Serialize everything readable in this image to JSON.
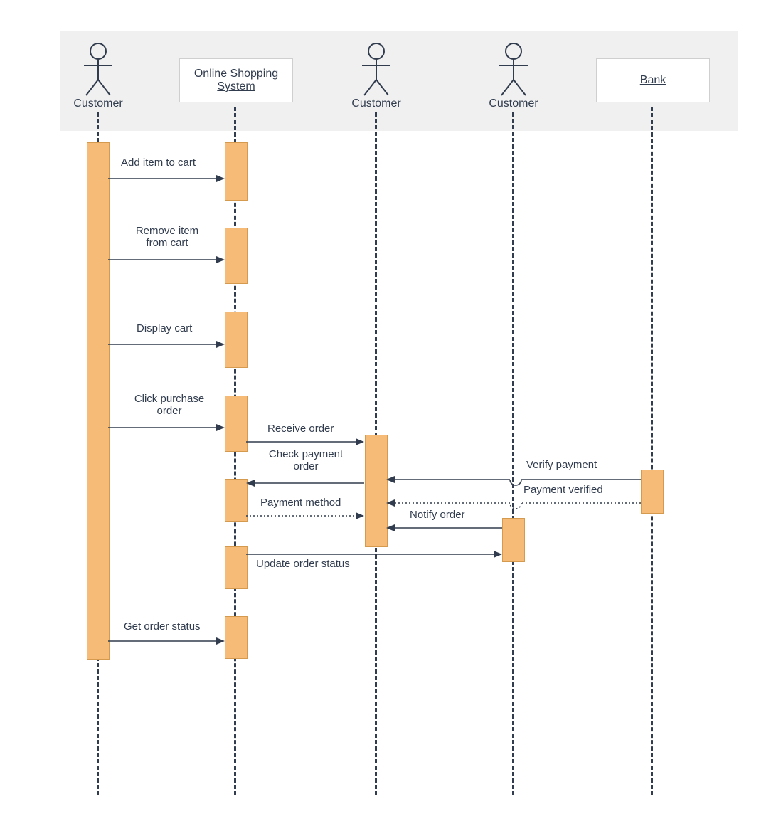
{
  "actors": {
    "customer1": "Customer",
    "customer2": "Customer",
    "customer3": "Customer",
    "system": "Online Shopping System",
    "bank": "Bank"
  },
  "messages": {
    "m1": "Add item to cart",
    "m2": "Remove item from cart",
    "m3": "Display cart",
    "m4": "Click purchase order",
    "m5": "Receive order",
    "m6": "Check payment order",
    "m7": "Payment method",
    "m8": "Verify payment",
    "m9": "Payment verified",
    "m10": "Notify order",
    "m11": "Update order status",
    "m12": "Get order status"
  },
  "chart_data": {
    "type": "sequence-diagram",
    "participants": [
      {
        "id": "customer1",
        "kind": "actor",
        "label": "Customer"
      },
      {
        "id": "system",
        "kind": "object",
        "label": "Online Shopping System"
      },
      {
        "id": "customer2",
        "kind": "actor",
        "label": "Customer"
      },
      {
        "id": "customer3",
        "kind": "actor",
        "label": "Customer"
      },
      {
        "id": "bank",
        "kind": "object",
        "label": "Bank"
      }
    ],
    "messages": [
      {
        "from": "customer1",
        "to": "system",
        "label": "Add item to cart",
        "style": "solid"
      },
      {
        "from": "customer1",
        "to": "system",
        "label": "Remove item from cart",
        "style": "solid"
      },
      {
        "from": "customer1",
        "to": "system",
        "label": "Display cart",
        "style": "solid"
      },
      {
        "from": "customer1",
        "to": "system",
        "label": "Click purchase order",
        "style": "solid"
      },
      {
        "from": "system",
        "to": "customer2",
        "label": "Receive order",
        "style": "solid"
      },
      {
        "from": "customer2",
        "to": "system",
        "label": "Check payment order",
        "style": "solid"
      },
      {
        "from": "system",
        "to": "customer2",
        "label": "Payment method",
        "style": "dotted"
      },
      {
        "from": "bank",
        "to": "customer2",
        "label": "Verify payment",
        "style": "solid"
      },
      {
        "from": "bank",
        "to": "customer2",
        "label": "Payment verified",
        "style": "dotted"
      },
      {
        "from": "customer3",
        "to": "customer2",
        "label": "Notify order",
        "style": "solid"
      },
      {
        "from": "system",
        "to": "customer3",
        "label": "Update order status",
        "style": "solid"
      },
      {
        "from": "customer1",
        "to": "system",
        "label": "Get order status",
        "style": "solid"
      }
    ]
  }
}
